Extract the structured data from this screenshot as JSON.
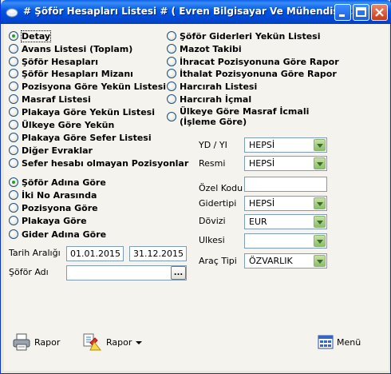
{
  "window": {
    "title": "# Şöför Hesapları Listesi #  ( Evren Bilgisayar Ve Mühendislik..."
  },
  "report_types_left": [
    "Detay",
    "Avans Listesi (Toplam)",
    "Şöför Hesapları",
    "Şöför Hesapları Mizanı",
    "Pozisyona Göre Yekün Listesi",
    "Masraf Listesi",
    "Plakaya Göre Yekün Listesi",
    "Ülkeye Göre Yekün",
    "Plakaya Göre Sefer Listesi",
    "Diğer Evraklar",
    "Sefer hesabı olmayan Pozisyonlar"
  ],
  "report_types_right": [
    "Şöför Giderleri Yekün Listesi",
    "Mazot Takibi",
    "İhracat Pozisyonuna Göre Rapor",
    "İthalat Pozisyonuna Göre Rapor",
    "Harcırah Listesi",
    "Harcırah İçmal",
    "Ülkeye Göre Masraf İcmali\n(İşleme Göre)"
  ],
  "grouping": [
    "Şöför Adına Göre",
    "İki No Arasında",
    "Pozisyona Göre",
    "Plakaya Göre",
    "Gider Adına Göre"
  ],
  "filters": {
    "yd_yi_label": "YD / YI",
    "yd_yi_value": "HEPSİ",
    "resmi_label": "Resmi",
    "resmi_value": "HEPSİ",
    "ozel_kodu_label": "Özel Kodu",
    "ozel_kodu_value": "",
    "gidertipi_label": "Gidertipi",
    "gidertipi_value": "HEPSİ",
    "dovizi_label": "Dövizi",
    "dovizi_value": "EUR",
    "ulkesi_label": "Ulkesi",
    "ulkesi_value": "",
    "arac_tipi_label": "Araç Tipi",
    "arac_tipi_value": "ÖZVARLIK"
  },
  "date_range": {
    "label": "Tarih Aralığı",
    "start": "01.01.2015",
    "end": "31.12.2015"
  },
  "driver": {
    "label": "Şöför Adı",
    "value": "",
    "browse": "..."
  },
  "buttons": {
    "rapor1": "Rapor",
    "rapor2": "Rapor",
    "menu": "Menü"
  },
  "selected": {
    "report_type": 0,
    "grouping": 0
  }
}
